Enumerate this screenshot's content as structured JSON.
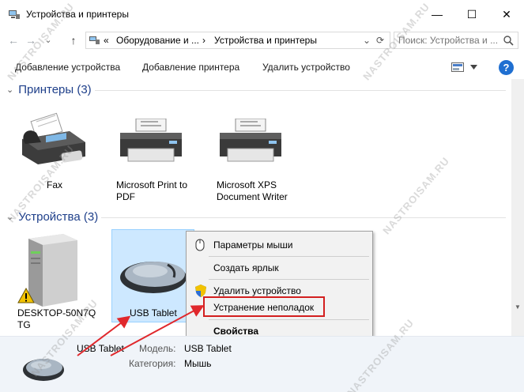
{
  "window": {
    "title": "Устройства и принтеры",
    "buttons": {
      "minimize": "—",
      "maximize": "☐",
      "close": "✕"
    }
  },
  "address": {
    "back": "←",
    "forward": "→",
    "dropdown": "⌄",
    "up": "↑",
    "overflow": "«",
    "crumb1": "Оборудование и ...",
    "sep": "›",
    "crumb2": "Устройства и принтеры",
    "refresh": "⟳",
    "search_placeholder": "Поиск: Устройства и ...",
    "search_icon": "search-icon"
  },
  "commands": {
    "add_device": "Добавление устройства",
    "add_printer": "Добавление принтера",
    "remove_device": "Удалить устройство",
    "help": "?"
  },
  "groups": {
    "printers": "Принтеры (3)",
    "devices": "Устройства (3)"
  },
  "printers": [
    {
      "label": "Fax"
    },
    {
      "label": "Microsoft Print to\nPDF"
    },
    {
      "label": "Microsoft XPS\nDocument Writer"
    }
  ],
  "devices": [
    {
      "label": "DESKTOP-50N7Q\nTG"
    },
    {
      "label": "USB Tablet"
    }
  ],
  "context_menu": [
    {
      "label": "Параметры мыши"
    },
    {
      "label": "Создать ярлык"
    },
    {
      "label": "Удалить устройство"
    },
    {
      "label": "Устранение неполадок"
    },
    {
      "label": "Свойства"
    }
  ],
  "details": {
    "name": "USB Tablet",
    "model_label": "Модель:",
    "model_value": "USB Tablet",
    "category_label": "Категория:",
    "category_value": "Мышь"
  },
  "watermark": "NASTROISAM.RU",
  "colors": {
    "accent": "#1f6fd1",
    "selection": "#cde8ff",
    "highlight_box": "#d31f1f",
    "group_header": "#1e3f8a"
  }
}
